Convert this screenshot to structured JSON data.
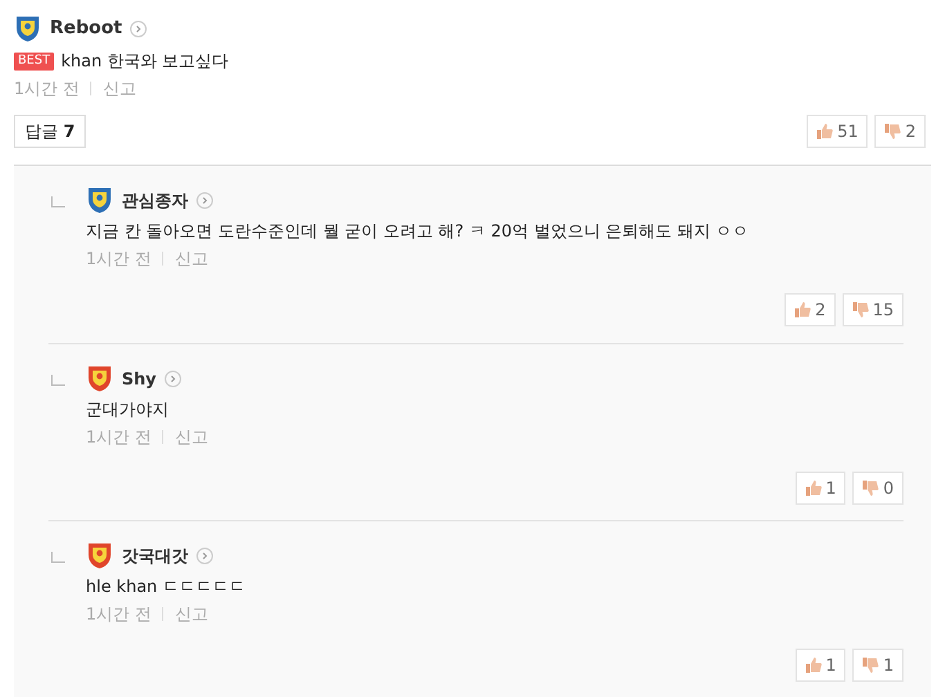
{
  "comment": {
    "author": "Reboot",
    "color": "#2d6fb5",
    "best": true,
    "best_label": "BEST",
    "text": "khan 한국와 보고싶다",
    "time": "1시간 전",
    "report": "신고",
    "reply_button": {
      "label": "답글",
      "count": "7"
    },
    "likes": "51",
    "dislikes": "2"
  },
  "replies": [
    {
      "author": "관심종자",
      "color": "#2d6fb5",
      "text": "지금 칸 돌아오면 도란수준인데 뭘 굳이 오려고 해? ㅋ 20억 벌었으니 은퇴해도 돼지 ㅇㅇ",
      "time": "1시간 전",
      "report": "신고",
      "likes": "2",
      "dislikes": "15"
    },
    {
      "author": "Shy",
      "color": "#e0452b",
      "text": "군대가야지",
      "time": "1시간 전",
      "report": "신고",
      "likes": "1",
      "dislikes": "0"
    },
    {
      "author": "갓국대갓",
      "color": "#e0452b",
      "text": "hle khan ㄷㄷㄷㄷㄷ",
      "time": "1시간 전",
      "report": "신고",
      "likes": "1",
      "dislikes": "1"
    }
  ]
}
